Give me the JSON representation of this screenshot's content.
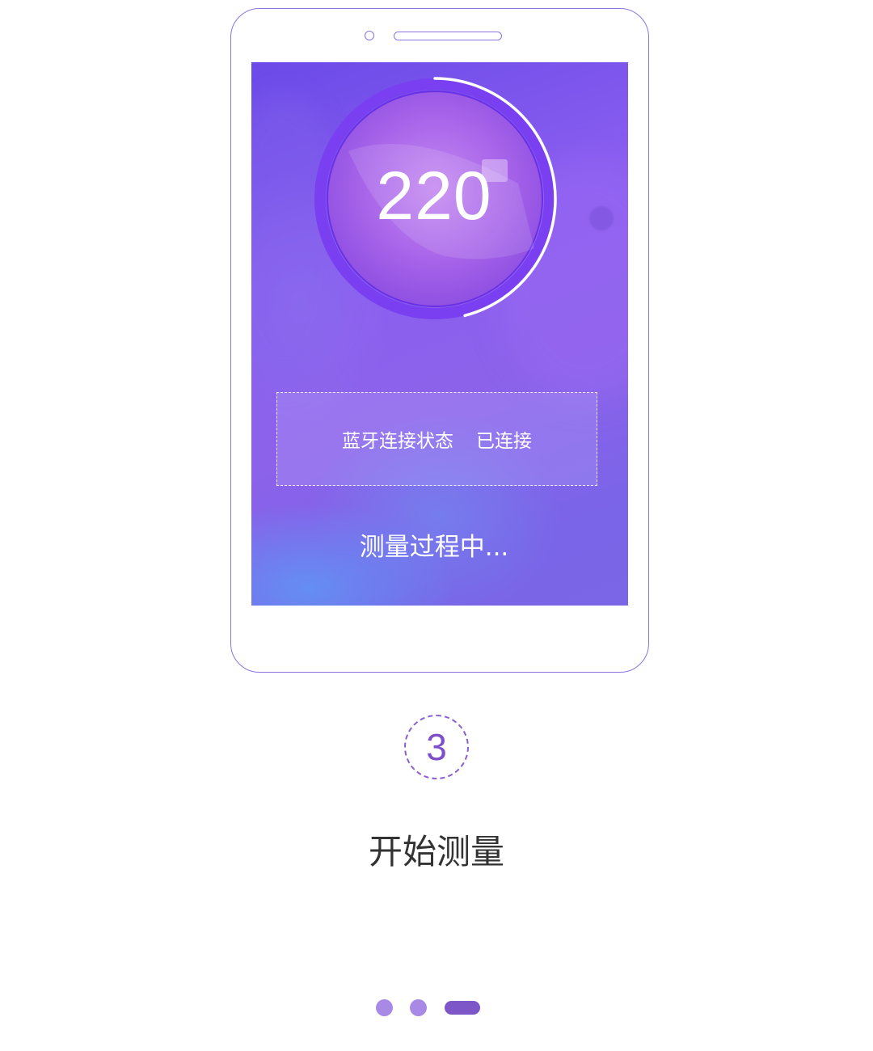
{
  "screen": {
    "dial_value": "220",
    "dial_progress": 0.46,
    "bluetooth_status_label": "蓝牙连接状态",
    "bluetooth_status_value": "已连接",
    "measuring_text": "测量过程中..."
  },
  "step": {
    "number": "3",
    "title": "开始测量"
  },
  "pagination": {
    "total_pages": 3,
    "active_page": 3
  },
  "colors": {
    "frame_outline": "#8b73e0",
    "accent_purple": "#7d57c7",
    "dot_inactive": "#a88ae6",
    "screen_gradient_top": "#6b4ae8",
    "screen_gradient_bottom": "#7a66e6"
  }
}
